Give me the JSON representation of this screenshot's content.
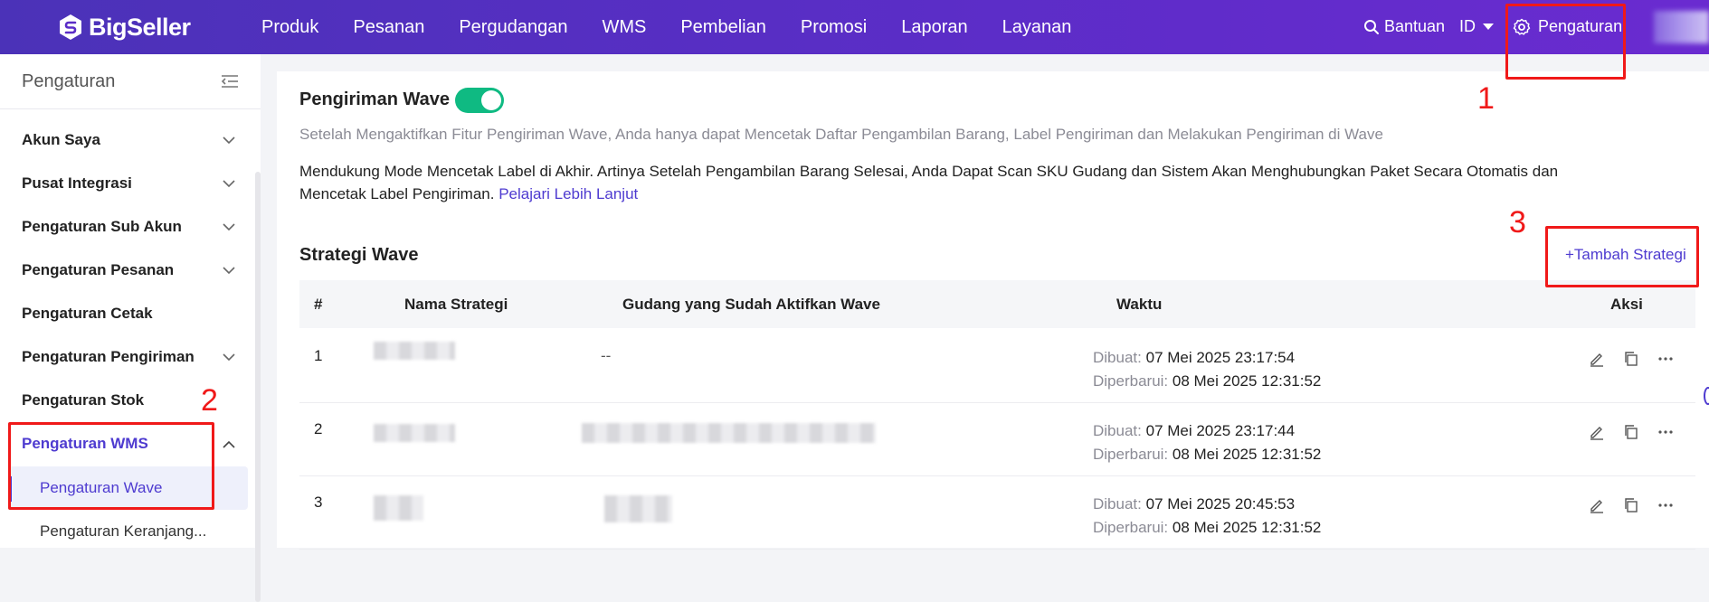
{
  "topbar": {
    "brand": "BigSeller",
    "nav": [
      "Produk",
      "Pesanan",
      "Pergudangan",
      "WMS",
      "Pembelian",
      "Promosi",
      "Laporan",
      "Layanan"
    ],
    "help": "Bantuan",
    "language": "ID",
    "settings": "Pengaturan"
  },
  "sidebar": {
    "title": "Pengaturan",
    "items": [
      {
        "label": "Akun Saya",
        "expandable": true
      },
      {
        "label": "Pusat Integrasi",
        "expandable": true
      },
      {
        "label": "Pengaturan Sub Akun",
        "expandable": true
      },
      {
        "label": "Pengaturan Pesanan",
        "expandable": true
      },
      {
        "label": "Pengaturan Cetak",
        "expandable": false
      },
      {
        "label": "Pengaturan Pengiriman",
        "expandable": true
      },
      {
        "label": "Pengaturan Stok",
        "expandable": false
      },
      {
        "label": "Pengaturan WMS",
        "expandable": true,
        "active": true
      }
    ],
    "subitems": [
      {
        "label": "Pengaturan Wave",
        "active": true
      },
      {
        "label": "Pengaturan Keranjang..."
      }
    ]
  },
  "main": {
    "wave_title": "Pengiriman Wave",
    "wave_enabled": true,
    "description": "Setelah Mengaktifkan Fitur Pengiriman Wave, Anda hanya dapat Mencetak Daftar Pengambilan Barang, Label Pengiriman dan Melakukan Pengiriman di Wave",
    "support_text": "Mendukung Mode Mencetak Label di Akhir. Artinya Setelah Pengambilan Barang Selesai, Anda Dapat Scan SKU Gudang dan Sistem Akan Menghubungkan Paket Secara Otomatis dan Mencetak Label Pengiriman.",
    "learn_more": "Pelajari Lebih Lanjut",
    "strategy_title": "Strategi Wave",
    "add_strategy": "+Tambah Strategi",
    "table": {
      "headers": [
        "#",
        "Nama Strategi",
        "Gudang yang Sudah Aktifkan Wave",
        "Waktu",
        "Aksi"
      ],
      "created_label": "Dibuat:",
      "updated_label": "Diperbarui:",
      "rows": [
        {
          "num": "1",
          "warehouse": "--",
          "created": "07 Mei 2025 23:17:54",
          "updated": "08 Mei 2025 12:31:52"
        },
        {
          "num": "2",
          "warehouse": "",
          "created": "07 Mei 2025 23:17:44",
          "updated": "08 Mei 2025 12:31:52"
        },
        {
          "num": "3",
          "warehouse": "",
          "created": "07 Mei 2025 20:45:53",
          "updated": "08 Mei 2025 12:31:52"
        }
      ]
    }
  },
  "annotations": [
    "1",
    "2",
    "3"
  ],
  "colors": {
    "topbar": "#5b2dc7",
    "accent": "#4e3bd0",
    "toggle": "#0fba82",
    "annotation": "#f01919"
  }
}
